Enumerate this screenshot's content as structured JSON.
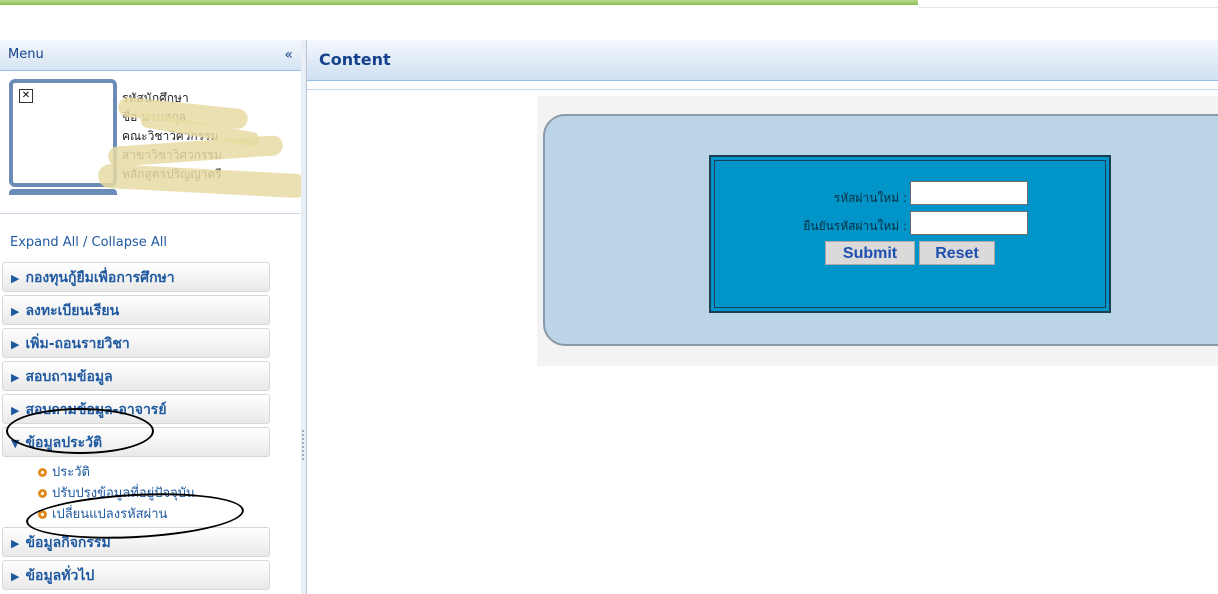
{
  "sidebar": {
    "header_title": "Menu",
    "collapse_icon": "«",
    "profile_lines": [
      "รหัสนักศึกษา",
      "ชื่อ นามสกุล",
      "คณะวิชาวิศวกรรม",
      "สาขาวิชาวิศวกรรม",
      "หลักสูตรปริญญาตรี"
    ],
    "expand_collapse_label": "Expand All / Collapse All",
    "items": [
      {
        "label": "กองทุนกู้ยืมเพื่อการศึกษา"
      },
      {
        "label": "ลงทะเบียนเรียน"
      },
      {
        "label": "เพิ่ม-ถอนรายวิชา"
      },
      {
        "label": "สอบถามข้อมูล"
      },
      {
        "label": "สอบถามข้อมูล-อาจารย์"
      },
      {
        "label": "ข้อมูลประวัติ"
      },
      {
        "label": "ข้อมูลกิจกรรม"
      },
      {
        "label": "ข้อมูลทั่วไป"
      }
    ],
    "subitems": [
      {
        "label": "ประวัติ"
      },
      {
        "label": "ปรับปรุงข้อมูลที่อยู่ปัจจุบัน"
      },
      {
        "label": "เปลี่ยนแปลงรหัสผ่าน"
      }
    ]
  },
  "content": {
    "title": "Content",
    "form": {
      "new_password_label": "รหัสผ่านใหม่ :",
      "confirm_password_label": "ยืนยันรหัสผ่านใหม่ :",
      "new_password_value": "",
      "confirm_password_value": "",
      "submit_label": "Submit",
      "reset_label": "Reset"
    }
  },
  "colors": {
    "nav_text": "#1f5aa0",
    "form_background": "#0094c8",
    "panel_background": "#bcd5e6"
  }
}
